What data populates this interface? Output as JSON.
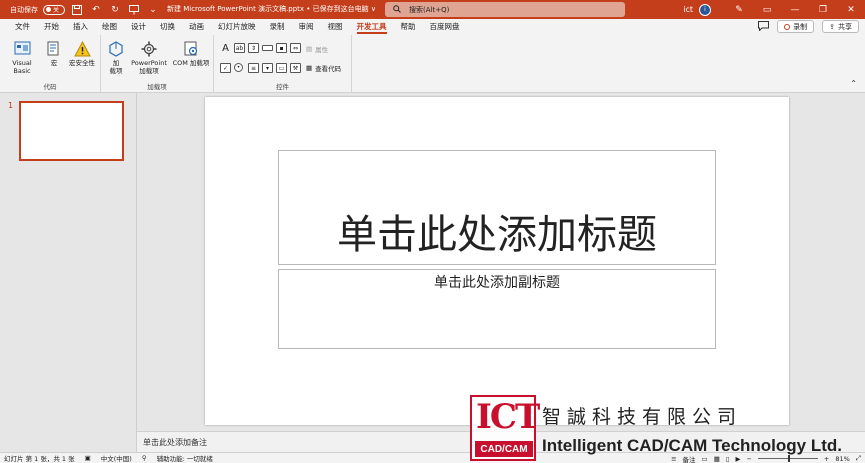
{
  "titlebar": {
    "autosave_label": "自动保存",
    "autosave_state": "关",
    "doc_title": "新建 Microsoft PowerPoint 演示文稿.pptx • 已保存到这台电脑 ∨",
    "search_placeholder": "搜索(Alt+Q)",
    "user": "ict",
    "avatar": "i"
  },
  "menu": {
    "tabs": [
      "文件",
      "开始",
      "插入",
      "绘图",
      "设计",
      "切换",
      "动画",
      "幻灯片放映",
      "录制",
      "审阅",
      "视图",
      "开发工具",
      "帮助",
      "百度网盘"
    ],
    "active_index": 11,
    "record_label": "录制",
    "share_label": "共享"
  },
  "ribbon": {
    "code_group": {
      "label": "代码",
      "visual_basic": "Visual Basic",
      "macro": "宏",
      "macro_security": "宏安全性"
    },
    "addins_group": {
      "label": "加载项",
      "addins_line1": "加",
      "addins_line2": "载项",
      "ppt_addins_line1": "PowerPoint",
      "ppt_addins_line2": "加载项",
      "com_addins": "COM 加载项"
    },
    "controls_group": {
      "label": "控件",
      "properties": "属性",
      "view_code": "查看代码"
    }
  },
  "slides_panel": {
    "slide_number": "1"
  },
  "slide": {
    "title_placeholder": "单击此处添加标题",
    "subtitle_placeholder": "单击此处添加副标题"
  },
  "notes": {
    "placeholder": "单击此处添加备注"
  },
  "statusbar": {
    "slide_info": "幻灯片 第 1 张，共 1 张",
    "language": "中文(中国)",
    "accessibility": "辅助功能: 一切就绪",
    "notes_label": "备注",
    "zoom": "81%"
  },
  "watermark": {
    "logo_main": "ICT",
    "logo_sub": "CAD/CAM",
    "company_cn": "智誠科技有限公司",
    "company_en": "Intelligent CAD/CAM Technology Ltd."
  },
  "colors": {
    "accent": "#c43e1c",
    "brand_red": "#c8102e"
  }
}
